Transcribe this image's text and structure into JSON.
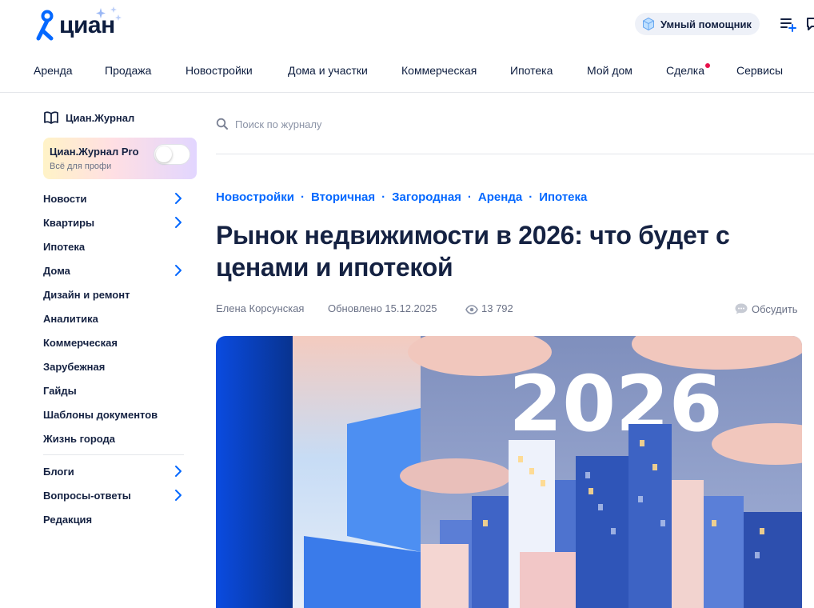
{
  "brand": {
    "name": "циан",
    "accent": "#0468ff",
    "dark": "#0d1d3f"
  },
  "header": {
    "assistant_label": "Умный помощник",
    "icons": [
      "cube-icon",
      "favorites-list-icon",
      "chat-icon"
    ]
  },
  "nav": {
    "items": [
      {
        "label": "Аренда"
      },
      {
        "label": "Продажа"
      },
      {
        "label": "Новостройки"
      },
      {
        "label": "Дома и участки"
      },
      {
        "label": "Коммерческая"
      },
      {
        "label": "Ипотека"
      },
      {
        "label": "Мой дом"
      },
      {
        "label": "Сделка",
        "badge_dot": true
      },
      {
        "label": "Сервисы"
      }
    ]
  },
  "sidebar": {
    "journal_title": "Циан.Журнал",
    "pro": {
      "title": "Циан.Журнал Pro",
      "subtitle": "Всё для профи",
      "toggle_on": false
    },
    "items": [
      {
        "label": "Новости",
        "chevron": true
      },
      {
        "label": "Квартиры",
        "chevron": true
      },
      {
        "label": "Ипотека",
        "chevron": false
      },
      {
        "label": "Дома",
        "chevron": true
      },
      {
        "label": "Дизайн и ремонт",
        "chevron": false
      },
      {
        "label": "Аналитика",
        "chevron": false
      },
      {
        "label": "Коммерческая",
        "chevron": false
      },
      {
        "label": "Зарубежная",
        "chevron": false
      },
      {
        "label": "Гайды",
        "chevron": false
      },
      {
        "label": "Шаблоны документов",
        "chevron": false
      },
      {
        "label": "Жизнь города",
        "chevron": false
      }
    ],
    "secondary_items": [
      {
        "label": "Блоги",
        "chevron": true
      },
      {
        "label": "Вопросы-ответы",
        "chevron": true
      },
      {
        "label": "Редакция",
        "chevron": false
      }
    ]
  },
  "search": {
    "placeholder": "Поиск по журналу",
    "value": ""
  },
  "article": {
    "categories": [
      "Новостройки",
      "Вторичная",
      "Загородная",
      "Аренда",
      "Ипотека"
    ],
    "category_separator": "·",
    "title_line1": "Рынок недвижимости в 2026: что будет с",
    "title_line2": "ценами и ипотекой",
    "author": "Елена Корсунская",
    "updated": "Обновлено 15.12.2025",
    "views": "13 792",
    "discuss_label": "Обсудить",
    "hero_text": "2026"
  }
}
